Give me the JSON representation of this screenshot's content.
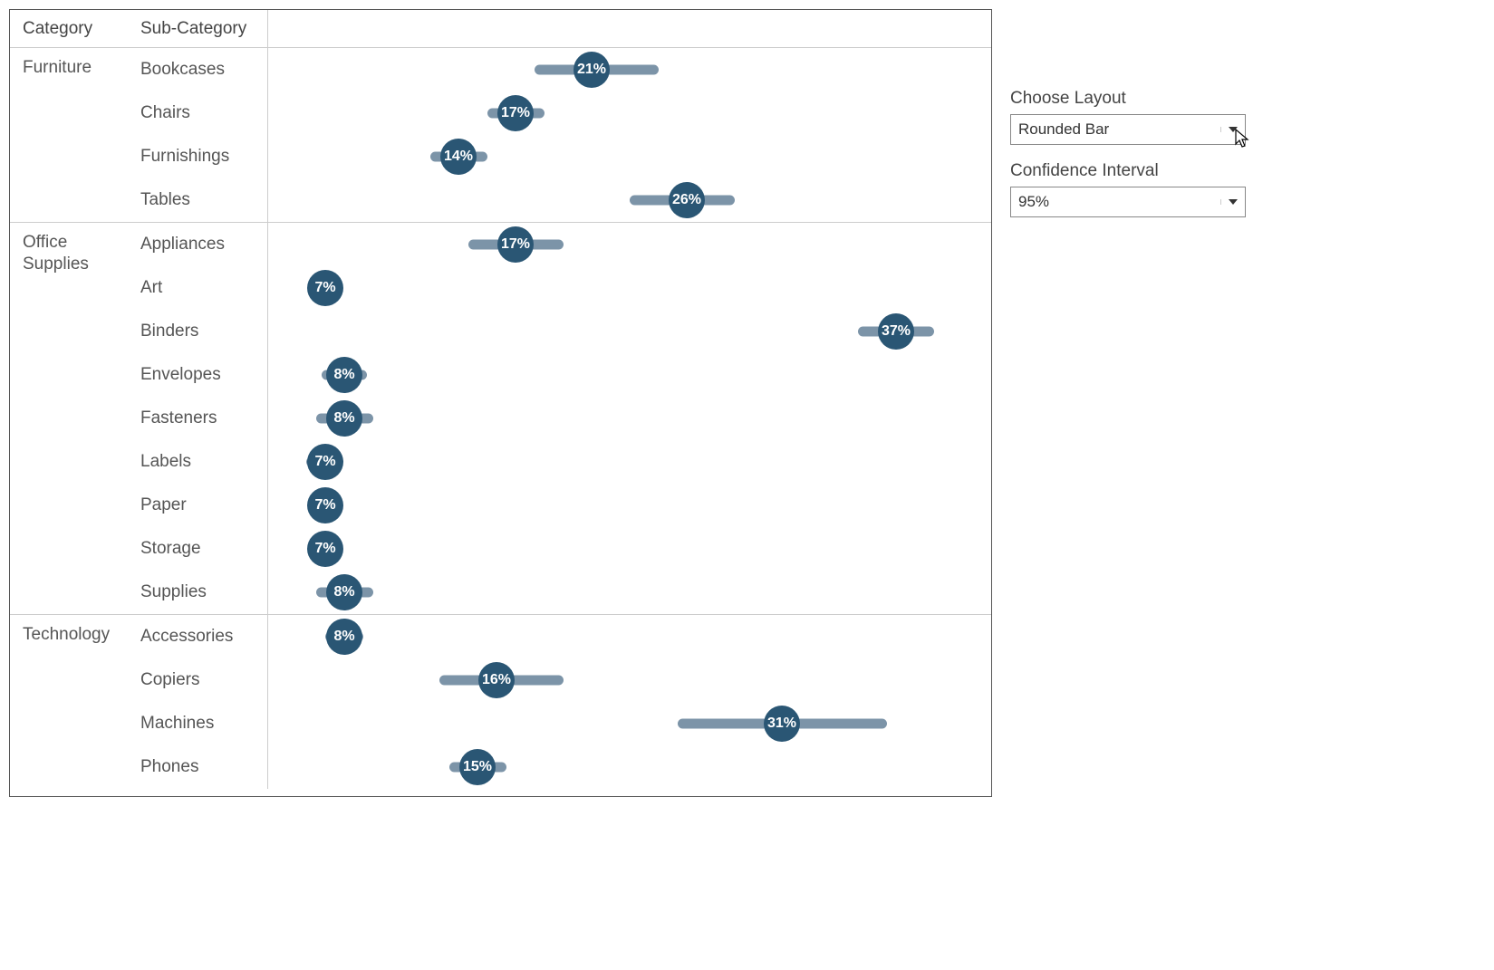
{
  "headers": {
    "category": "Category",
    "sub_category": "Sub-Category"
  },
  "chart_data": {
    "type": "dot-plot-with-ci",
    "x_range_pct": [
      4,
      42
    ],
    "colors": {
      "dot": "#2a5674",
      "bar": "#7c94a8"
    },
    "categories": [
      {
        "name": "Furniture",
        "rows": [
          {
            "label": "Bookcases",
            "value": 21,
            "ci_low": 18.0,
            "ci_high": 24.5
          },
          {
            "label": "Chairs",
            "value": 17,
            "ci_low": 15.5,
            "ci_high": 18.5
          },
          {
            "label": "Furnishings",
            "value": 14,
            "ci_low": 12.5,
            "ci_high": 15.5
          },
          {
            "label": "Tables",
            "value": 26,
            "ci_low": 23.0,
            "ci_high": 28.5
          }
        ]
      },
      {
        "name": "Office Supplies",
        "rows": [
          {
            "label": "Appliances",
            "value": 17,
            "ci_low": 14.5,
            "ci_high": 19.5
          },
          {
            "label": "Art",
            "value": 7,
            "ci_low": 6.5,
            "ci_high": 7.5
          },
          {
            "label": "Binders",
            "value": 37,
            "ci_low": 35.0,
            "ci_high": 39.0
          },
          {
            "label": "Envelopes",
            "value": 8,
            "ci_low": 6.8,
            "ci_high": 9.2
          },
          {
            "label": "Fasteners",
            "value": 8,
            "ci_low": 6.5,
            "ci_high": 9.5
          },
          {
            "label": "Labels",
            "value": 7,
            "ci_low": 6.0,
            "ci_high": 7.8
          },
          {
            "label": "Paper",
            "value": 7,
            "ci_low": 6.5,
            "ci_high": 7.5
          },
          {
            "label": "Storage",
            "value": 7,
            "ci_low": 6.5,
            "ci_high": 7.5
          },
          {
            "label": "Supplies",
            "value": 8,
            "ci_low": 6.5,
            "ci_high": 9.5
          }
        ]
      },
      {
        "name": "Technology",
        "rows": [
          {
            "label": "Accessories",
            "value": 8,
            "ci_low": 7.0,
            "ci_high": 9.0
          },
          {
            "label": "Copiers",
            "value": 16,
            "ci_low": 13.0,
            "ci_high": 19.5
          },
          {
            "label": "Machines",
            "value": 31,
            "ci_low": 25.5,
            "ci_high": 36.5
          },
          {
            "label": "Phones",
            "value": 15,
            "ci_low": 13.5,
            "ci_high": 16.5
          }
        ]
      }
    ]
  },
  "controls": {
    "layout": {
      "label": "Choose Layout",
      "value": "Rounded Bar"
    },
    "confidence": {
      "label": "Confidence Interval",
      "value": "95%"
    }
  }
}
